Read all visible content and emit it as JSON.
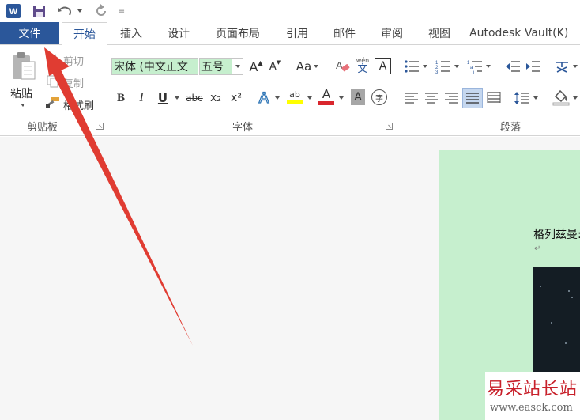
{
  "qat": {
    "word_logo": "W",
    "customize": "="
  },
  "tabs": {
    "file": "文件",
    "items": [
      "开始",
      "插入",
      "设计",
      "页面布局",
      "引用",
      "邮件",
      "审阅",
      "视图",
      "Autodesk Vault(K)"
    ]
  },
  "clipboard": {
    "paste": "粘贴",
    "cut": "剪切",
    "copy": "复制",
    "format_painter": "格式刷",
    "group_label": "剪贴板"
  },
  "font": {
    "font_name": "宋体 (中文正文",
    "font_size": "五号",
    "grow": "A",
    "shrink": "A",
    "change_case": "Aa",
    "phonetic_top": "wén",
    "phonetic_bottom": "文",
    "char_border": "A",
    "bold": "B",
    "italic": "I",
    "underline": "U",
    "strike": "abc",
    "subscript": "x₂",
    "superscript": "x²",
    "text_effect": "A",
    "highlight": "ab",
    "font_color": "A",
    "shading": "A",
    "enclose": "字",
    "group_label": "字体"
  },
  "paragraph": {
    "group_label": "段落"
  },
  "document": {
    "text": "格列兹曼:",
    "paragraph_mark": "↵"
  },
  "watermark": {
    "title": "易采站长站",
    "url": "www.easck.com"
  },
  "colors": {
    "brand_blue": "#2b579a",
    "page_green": "#c6efce",
    "highlight_yellow": "#ffff00",
    "font_red": "#d9262d",
    "arrow_red": "#e03c32"
  }
}
